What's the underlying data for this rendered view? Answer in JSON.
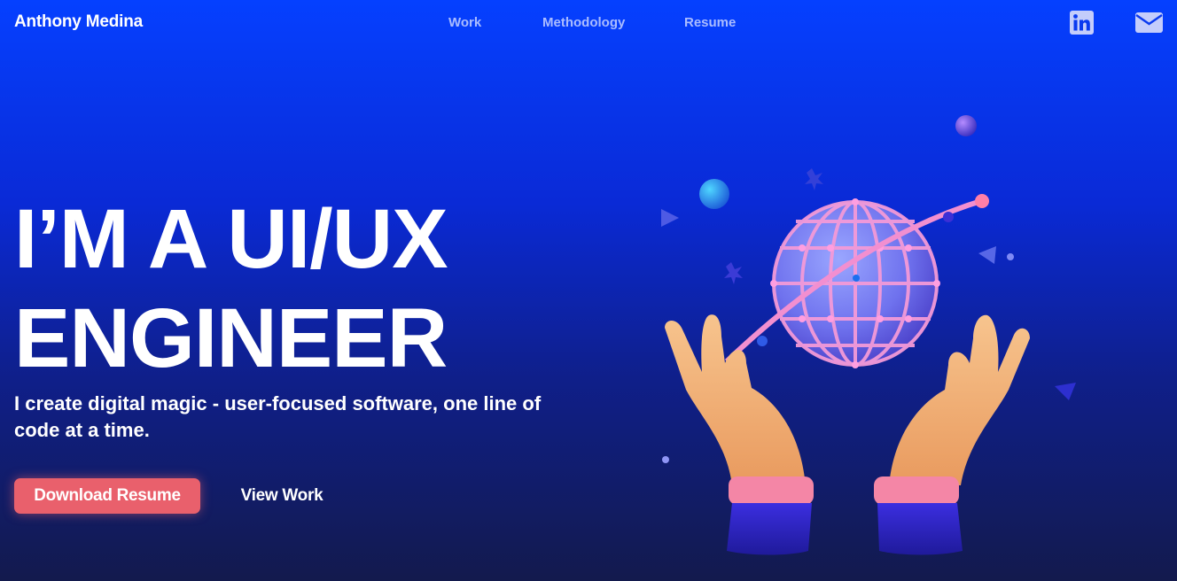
{
  "nav": {
    "brand": "Anthony Medina",
    "links": [
      {
        "label": "Work"
      },
      {
        "label": "Methodology"
      },
      {
        "label": "Resume"
      }
    ],
    "social": [
      {
        "icon": "linkedin-icon"
      },
      {
        "icon": "mail-icon"
      }
    ]
  },
  "hero": {
    "headline_line1": "I’M A UI/UX",
    "headline_line2": "ENGINEER",
    "subhead": "I create digital magic - user-focused software, one line of code at a time.",
    "primary_button": "Download Resume",
    "secondary_button": "View Work",
    "illustration": "hands-holding-planet-illustration"
  },
  "colors": {
    "gradient_top": "#0540ff",
    "gradient_bottom": "#131a4d",
    "primary_button": "#e9606c",
    "nav_link": "#c8d2ff",
    "text": "#ffffff"
  }
}
